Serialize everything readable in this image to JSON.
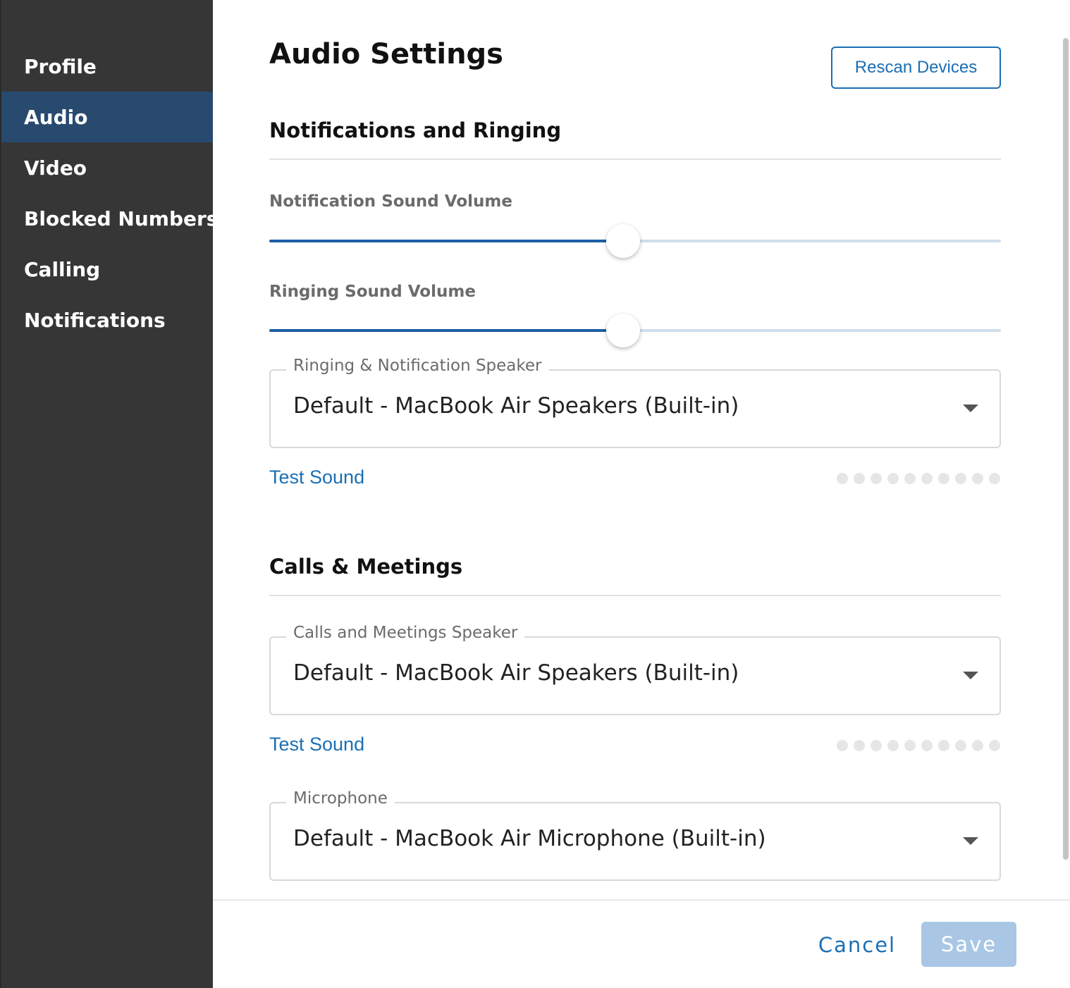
{
  "sidebar": {
    "items": [
      {
        "label": "Profile",
        "active": false
      },
      {
        "label": "Audio",
        "active": true
      },
      {
        "label": "Video",
        "active": false
      },
      {
        "label": "Blocked Numbers",
        "active": false
      },
      {
        "label": "Calling",
        "active": false
      },
      {
        "label": "Notifications",
        "active": false
      }
    ]
  },
  "header": {
    "title": "Audio Settings",
    "rescan_label": "Rescan Devices"
  },
  "notifications_section": {
    "title": "Notifications and Ringing",
    "notification_volume": {
      "label": "Notification Sound Volume",
      "value_percent": 48
    },
    "ringing_volume": {
      "label": "Ringing Sound Volume",
      "value_percent": 48
    },
    "speaker_select": {
      "label": "Ringing & Notification Speaker",
      "value": "Default - MacBook Air Speakers (Built-in)"
    },
    "test_sound_label": "Test Sound",
    "level_meter": {
      "dots": 10,
      "level": 0
    }
  },
  "calls_section": {
    "title": "Calls & Meetings",
    "speaker_select": {
      "label": "Calls and Meetings Speaker",
      "value": "Default - MacBook Air Speakers (Built-in)"
    },
    "test_sound_label": "Test Sound",
    "level_meter": {
      "dots": 10,
      "level": 0
    },
    "microphone_select": {
      "label": "Microphone",
      "value": "Default - MacBook Air Microphone (Built-in)"
    }
  },
  "footer": {
    "cancel_label": "Cancel",
    "save_label": "Save"
  },
  "colors": {
    "sidebar_bg": "#363636",
    "active_item_bg": "#274a6e",
    "accent": "#1a6fb5",
    "slider_fill": "#1b5ea5",
    "save_disabled_bg": "#a9c6e5"
  }
}
